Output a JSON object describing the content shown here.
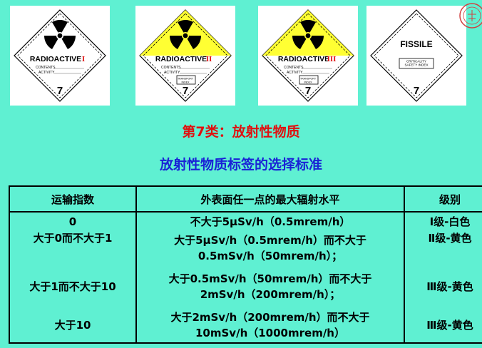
{
  "labels": [
    {
      "main_text": "RADIOACTIVE",
      "category": "I",
      "line1": "CONTENTS",
      "line2": "ACTIVITY",
      "class_number": "7",
      "background": "#ffffff",
      "symbol": "trefoil-icon"
    },
    {
      "main_text": "RADIOACTIVE",
      "category": "II",
      "line1": "CONTENTS",
      "line2": "ACTIVITY",
      "index_box": "TRANSPORT INDEX",
      "class_number": "7",
      "background": "#ffff33",
      "symbol": "trefoil-icon"
    },
    {
      "main_text": "RADIOACTIVE",
      "category": "III",
      "line1": "CONTENTS",
      "line2": "ACTIVITY",
      "index_box": "TRANSPORT INDEX",
      "class_number": "7",
      "background": "#ffff33",
      "symbol": "trefoil-icon"
    },
    {
      "main_text": "FISSILE",
      "index_box": "CRITICALITY SAFETY INDEX",
      "class_number": "7",
      "background": "#ffffff"
    }
  ],
  "class_title": "第7类：放射性物质",
  "section_title": "放射性物质标签的选择标准",
  "table": {
    "headers": [
      "运输指数",
      "外表面任一点的最大辐射水平",
      "级别"
    ],
    "rows": [
      {
        "index": "0",
        "level": [
          "不大于5μSv/h（0.5mrem/h）"
        ],
        "grade": "Ⅰ级-白色"
      },
      {
        "index": "大于0而不大于1",
        "level": [
          "大于5μSv/h（0.5mrem/h）而不大于",
          "0.5mSv/h（50mrem/h）；"
        ],
        "grade": "Ⅱ级-黄色"
      },
      {
        "index": "大于1而不大于10",
        "level": [
          "大于0.5mSv/h（50mrem/h）而不大于",
          "2mSv/h（200mrem/h）；"
        ],
        "grade": "Ⅲ级-黄色"
      },
      {
        "index": "大于10",
        "level": [
          "大于2mSv/h（200mrem/h）而不大于",
          "10mSv/h（1000mrem/h）"
        ],
        "grade": "Ⅲ级-黄色"
      }
    ]
  },
  "colors": {
    "background": "#5ff0d2",
    "title_red": "#e01010",
    "title_blue": "#1a22d6",
    "category_red": "#e01010"
  }
}
